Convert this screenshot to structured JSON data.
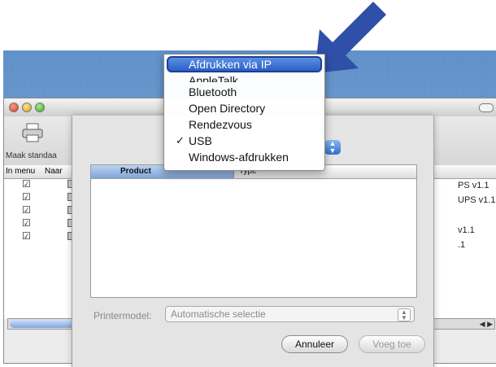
{
  "menu": {
    "items": [
      {
        "label": "Afdrukken via IP",
        "checked": false,
        "highlighted": true
      },
      {
        "label": "AppleTalk",
        "checked": false
      },
      {
        "label": "Bluetooth",
        "checked": false
      },
      {
        "label": "Open Directory",
        "checked": false
      },
      {
        "label": "Rendezvous",
        "checked": false
      },
      {
        "label": "USB",
        "checked": true
      },
      {
        "label": "Windows-afdrukken",
        "checked": false
      }
    ],
    "check_glyph": "✓"
  },
  "background_window": {
    "toolbar_label": "Maak standaa",
    "columns": {
      "in_menu": "In menu",
      "name": "Naar"
    },
    "rows": [
      {
        "right_text": "PS v1.1"
      },
      {
        "right_text": "UPS v1.1"
      },
      {
        "right_text": ""
      },
      {
        "right_text": "v1.1"
      },
      {
        "right_text": ".1"
      }
    ]
  },
  "sheet": {
    "table": {
      "col_product": "Product",
      "col_type": "Type"
    },
    "printer_model_label": "Printermodel:",
    "printer_model_value": "Automatische selectie",
    "cancel_label": "Annuleer",
    "add_label": "Voeg toe"
  },
  "colors": {
    "highlight": "#2a60c8",
    "desktop": "#6d9bd0",
    "arrow": "#2f4fa8"
  },
  "icons": [
    "printer-icon",
    "checkbox-icon",
    "arrow-pointer-icon",
    "chevron-updown-icon"
  ]
}
